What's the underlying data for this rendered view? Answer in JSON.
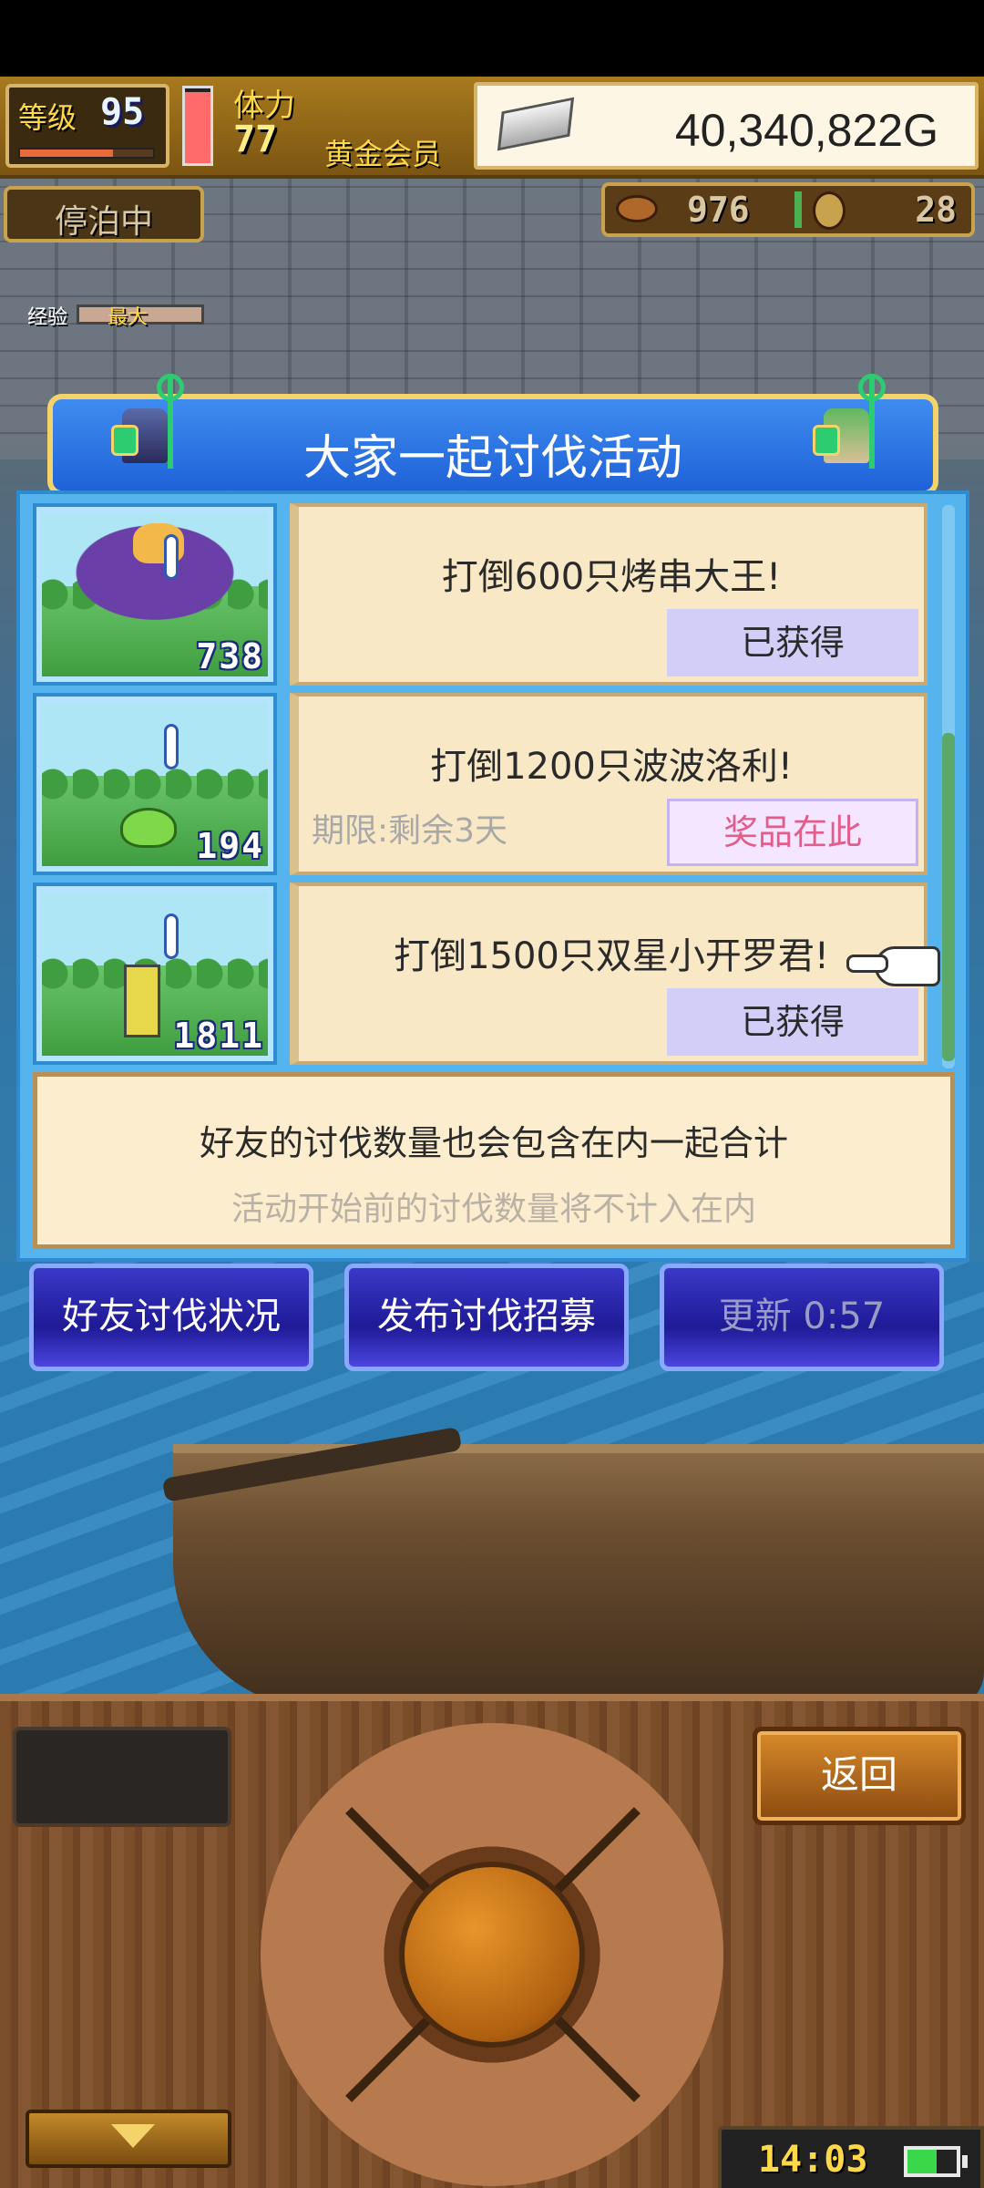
{
  "hud": {
    "level_label": "等级",
    "level": "95",
    "level_progress": 0.7,
    "hp_fraction": 0.95,
    "stamina_label": "体力",
    "stamina": "77",
    "membership": "黄金会员",
    "gold": "40,340,822G"
  },
  "status": {
    "dock_label": "停泊中",
    "resource1": "976",
    "resource2": "28",
    "exp_label": "经验",
    "exp_max_label": "最大"
  },
  "event": {
    "title": "大家一起讨伐活动",
    "quests": [
      {
        "text": "打倒600只烤串大王!",
        "count": "738",
        "status": "已获得"
      },
      {
        "text": "打倒1200只波波洛利!",
        "count": "194",
        "status": "奖品在此",
        "deadline": "期限:剩余3天"
      },
      {
        "text": "打倒1500只双星小开罗君!",
        "count": "1811",
        "status": "已获得"
      }
    ],
    "note_line1": "好友的讨伐数量也会包含在内一起合计",
    "note_line2": "活动开始前的讨伐数量将不计入在内"
  },
  "actions": {
    "friends": "好友讨伐状况",
    "recruit": "发布讨伐招募",
    "refresh": "更新 0:57"
  },
  "controls": {
    "back": "返回",
    "clock": "14:03",
    "battery_level": 0.6
  },
  "colors": {
    "title_bar": "#1f62d8",
    "panel": "#55b4ee",
    "card": "#f8e8c6",
    "claimed_button": "#d2cef8",
    "claim_text": "#e35c8a"
  }
}
